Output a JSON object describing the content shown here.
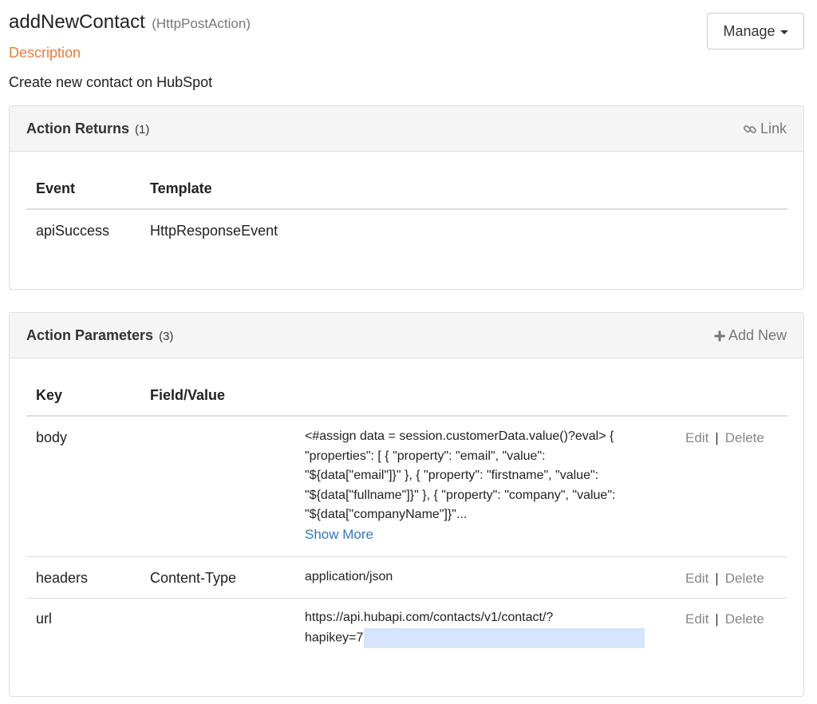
{
  "header": {
    "title": "addNewContact",
    "subtitle": "(HttpPostAction)",
    "manage_label": "Manage",
    "description_heading": "Description",
    "description_text": "Create new contact on HubSpot"
  },
  "returns_panel": {
    "title": "Action Returns",
    "count": "(1)",
    "action_label": "Link",
    "action_icon": "link-icon",
    "columns": [
      "Event",
      "Template"
    ],
    "rows": [
      {
        "event": "apiSuccess",
        "template": "HttpResponseEvent"
      }
    ]
  },
  "params_panel": {
    "title": "Action Parameters",
    "count": "(3)",
    "action_label": "Add New",
    "action_icon": "plus-icon",
    "columns": [
      "Key",
      "Field/Value"
    ],
    "edit_label": "Edit",
    "delete_label": "Delete",
    "separator": "|",
    "show_more_label": "Show More",
    "rows": [
      {
        "key": "body",
        "field": "",
        "value_lines": [
          "<#assign data = session.customerData.value()?eval> {",
          "\"properties\": [ { \"property\": \"email\", \"value\":",
          "\"${data[\"email\"]}\" }, { \"property\": \"firstname\", \"value\":",
          "\"${data[\"fullname\"]}\" }, { \"property\": \"company\", \"value\":",
          "\"${data[\"companyName\"]}\"..."
        ]
      },
      {
        "key": "headers",
        "field": "Content-Type",
        "value": "application/json"
      },
      {
        "key": "url",
        "field": "",
        "value_line1": "https://api.hubapi.com/contacts/v1/contact/?",
        "value_line2_prefix": "hapikey=7"
      }
    ]
  },
  "colors": {
    "accent_orange": "#e67e3a",
    "link_blue": "#337ab7",
    "redaction": "#d6e4fc"
  }
}
